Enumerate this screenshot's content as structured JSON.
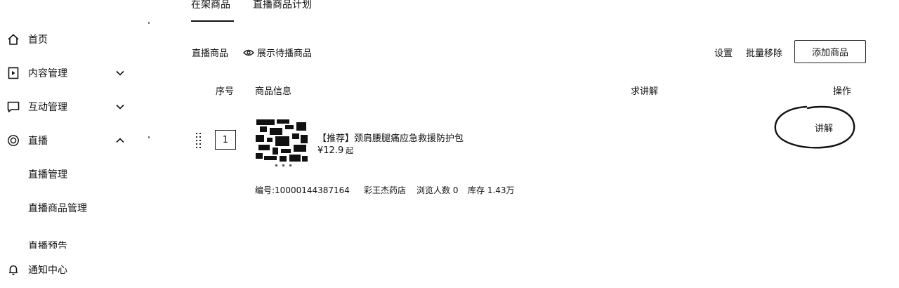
{
  "tabs": [
    {
      "label": "在架商品",
      "active": true
    },
    {
      "label": "直播商品计划",
      "active": false
    }
  ],
  "sidebar": {
    "items": [
      {
        "label": "首页",
        "icon": "home-icon"
      },
      {
        "label": "内容管理",
        "icon": "content-icon",
        "chevron": "down"
      },
      {
        "label": "互动管理",
        "icon": "message-icon",
        "chevron": "down"
      },
      {
        "label": "直播",
        "icon": "live-icon",
        "chevron": "up"
      },
      {
        "label": "直播管理"
      },
      {
        "label": "直播商品管理"
      },
      {
        "label": "直播预告"
      },
      {
        "label": "通知中心",
        "icon": "bell-icon"
      }
    ]
  },
  "toolbar": {
    "title": "直播商品",
    "show_pending": "展示待播商品",
    "settings": "设置",
    "batch_remove": "批量移除",
    "add_product": "添加商品"
  },
  "table": {
    "headers": {
      "seq": "序号",
      "info": "商品信息",
      "request": "求讲解",
      "actions": "操作"
    }
  },
  "product": {
    "seq": "1",
    "title": "【推荐】颈肩腰腿痛应急救援防护包",
    "price": "¥12.9",
    "price_suffix": "起",
    "code": "编号:10000144387164",
    "shop": "彩王杰药店",
    "views": "浏览人数 0",
    "stock": "库存 1.43万",
    "action": "讲解"
  }
}
